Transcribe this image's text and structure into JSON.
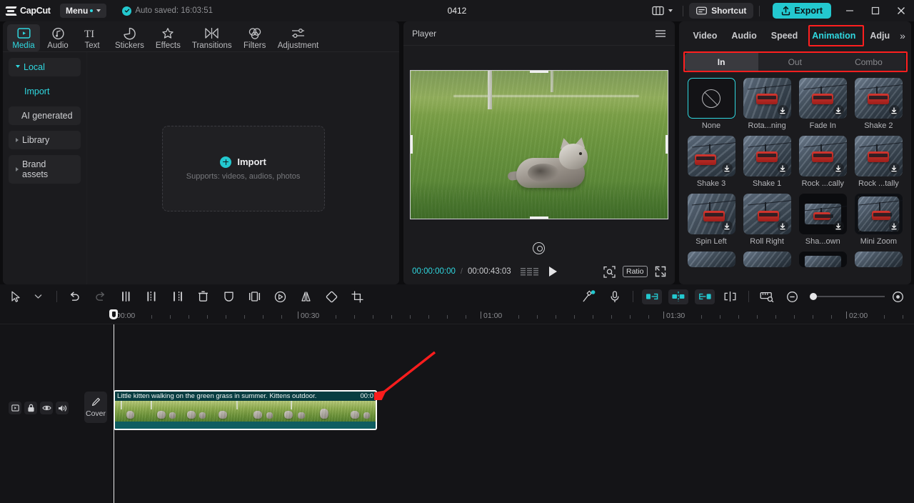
{
  "titlebar": {
    "brand": "CapCut",
    "menu_label": "Menu",
    "autosave_text": "Auto saved: 16:03:51",
    "doc_title": "0412",
    "layout_icon": "layout-grid-icon",
    "shortcut_label": "Shortcut",
    "export_label": "Export",
    "window_buttons": [
      "minimize",
      "maximize",
      "close"
    ]
  },
  "left_panel": {
    "tabs": [
      {
        "label": "Media",
        "icon": "media-play-icon",
        "active": true
      },
      {
        "label": "Audio",
        "icon": "audio-note-icon",
        "active": false
      },
      {
        "label": "Text",
        "icon": "text-ti-icon",
        "active": false
      },
      {
        "label": "Stickers",
        "icon": "sticker-icon",
        "active": false
      },
      {
        "label": "Effects",
        "icon": "effects-sparkle-icon",
        "active": false
      },
      {
        "label": "Transitions",
        "icon": "transitions-icon",
        "active": false
      },
      {
        "label": "Filters",
        "icon": "filters-circles-icon",
        "active": false
      },
      {
        "label": "Adjustment",
        "icon": "adjustment-sliders-icon",
        "active": false
      }
    ],
    "nav": [
      {
        "label": "Local",
        "type": "expandable-open",
        "accent": true
      },
      {
        "label": "Import",
        "type": "plain",
        "accent": true
      },
      {
        "label": "AI generated",
        "type": "plain-chip",
        "accent": false
      },
      {
        "label": "Library",
        "type": "expandable",
        "accent": false
      },
      {
        "label": "Brand assets",
        "type": "expandable",
        "accent": false
      }
    ],
    "dropzone": {
      "title": "Import",
      "subtitle": "Supports: videos, audios, photos",
      "icon": "plus-circle-icon"
    }
  },
  "player": {
    "header_title": "Player",
    "menu_icon": "hamburger-icon",
    "current_time": "00:00:00:00",
    "separator": "/",
    "total_time": "00:00:43:03",
    "quality_icon": "quality-bars-icon",
    "play_icon": "play-icon",
    "zoom_icon": "zoom-fit-icon",
    "ratio_label": "Ratio",
    "fullscreen_icon": "fullscreen-icon",
    "rotate_icon": "rotate-handle-icon"
  },
  "right_panel": {
    "tabs": [
      {
        "label": "Video",
        "active": false
      },
      {
        "label": "Audio",
        "active": false
      },
      {
        "label": "Speed",
        "active": false
      },
      {
        "label": "Animation",
        "active": true
      },
      {
        "label": "Adju",
        "active": false
      }
    ],
    "more_icon": "chevron-double-right-icon",
    "segments": [
      {
        "label": "In",
        "active": true
      },
      {
        "label": "Out",
        "active": false
      },
      {
        "label": "Combo",
        "active": false
      }
    ],
    "animations": [
      {
        "label": "None",
        "kind": "none",
        "selected": true,
        "downloadable": false
      },
      {
        "label": "Rota...ning",
        "kind": "rot",
        "selected": false,
        "downloadable": true
      },
      {
        "label": "Fade In",
        "kind": "plain",
        "selected": false,
        "downloadable": true
      },
      {
        "label": "Shake 2",
        "kind": "plain",
        "selected": false,
        "downloadable": true
      },
      {
        "label": "Shake 3",
        "kind": "rollr",
        "selected": false,
        "downloadable": true
      },
      {
        "label": "Shake 1",
        "kind": "plain",
        "selected": false,
        "downloadable": true
      },
      {
        "label": "Rock ...cally",
        "kind": "plain",
        "selected": false,
        "downloadable": true
      },
      {
        "label": "Rock ...tally",
        "kind": "plain",
        "selected": false,
        "downloadable": true
      },
      {
        "label": "Spin Left",
        "kind": "spinl",
        "selected": false,
        "downloadable": true
      },
      {
        "label": "Roll Right",
        "kind": "rollr",
        "selected": false,
        "downloadable": true
      },
      {
        "label": "Sha...own",
        "kind": "inner",
        "selected": false,
        "downloadable": true
      },
      {
        "label": "Mini Zoom",
        "kind": "mini",
        "selected": false,
        "downloadable": true
      }
    ],
    "highlight_color": "#ff1f1f",
    "accent_color": "#2fd8e0"
  },
  "toolbar": {
    "left_tools": [
      "select-cursor-icon",
      "cursor-dropdown-icon",
      "undo-icon",
      "redo-icon",
      "split-left-icon",
      "split-center-icon",
      "split-right-icon",
      "delete-icon",
      "mask-shield-icon",
      "crop-frames-icon",
      "keyframe-icon",
      "mirror-icon",
      "rotate-shape-icon",
      "crop-icon"
    ],
    "right_tools": [
      "magic-wand-icon",
      "microphone-icon",
      "snap-left-icon",
      "snap-center-icon",
      "snap-right-icon",
      "link-split-icon",
      "preview-ruler-icon",
      "zoom-out-icon",
      "zoom-slider",
      "zoom-in-icon"
    ]
  },
  "timeline": {
    "ruler_labels": [
      "00:00",
      "00:30",
      "01:00",
      "01:30",
      "02:00"
    ],
    "track_control_icons": [
      "track-toggle-icon",
      "lock-icon",
      "eye-icon",
      "volume-icon"
    ],
    "cover_label": "Cover",
    "cover_icon": "pencil-icon",
    "clip": {
      "title": "Little kitten walking on the green grass in summer. Kittens outdoor.",
      "duration": "00:0"
    },
    "playhead_time": "00:00"
  },
  "annotation": {
    "arrow": "red-arrow-pointing-to-clip-end"
  }
}
